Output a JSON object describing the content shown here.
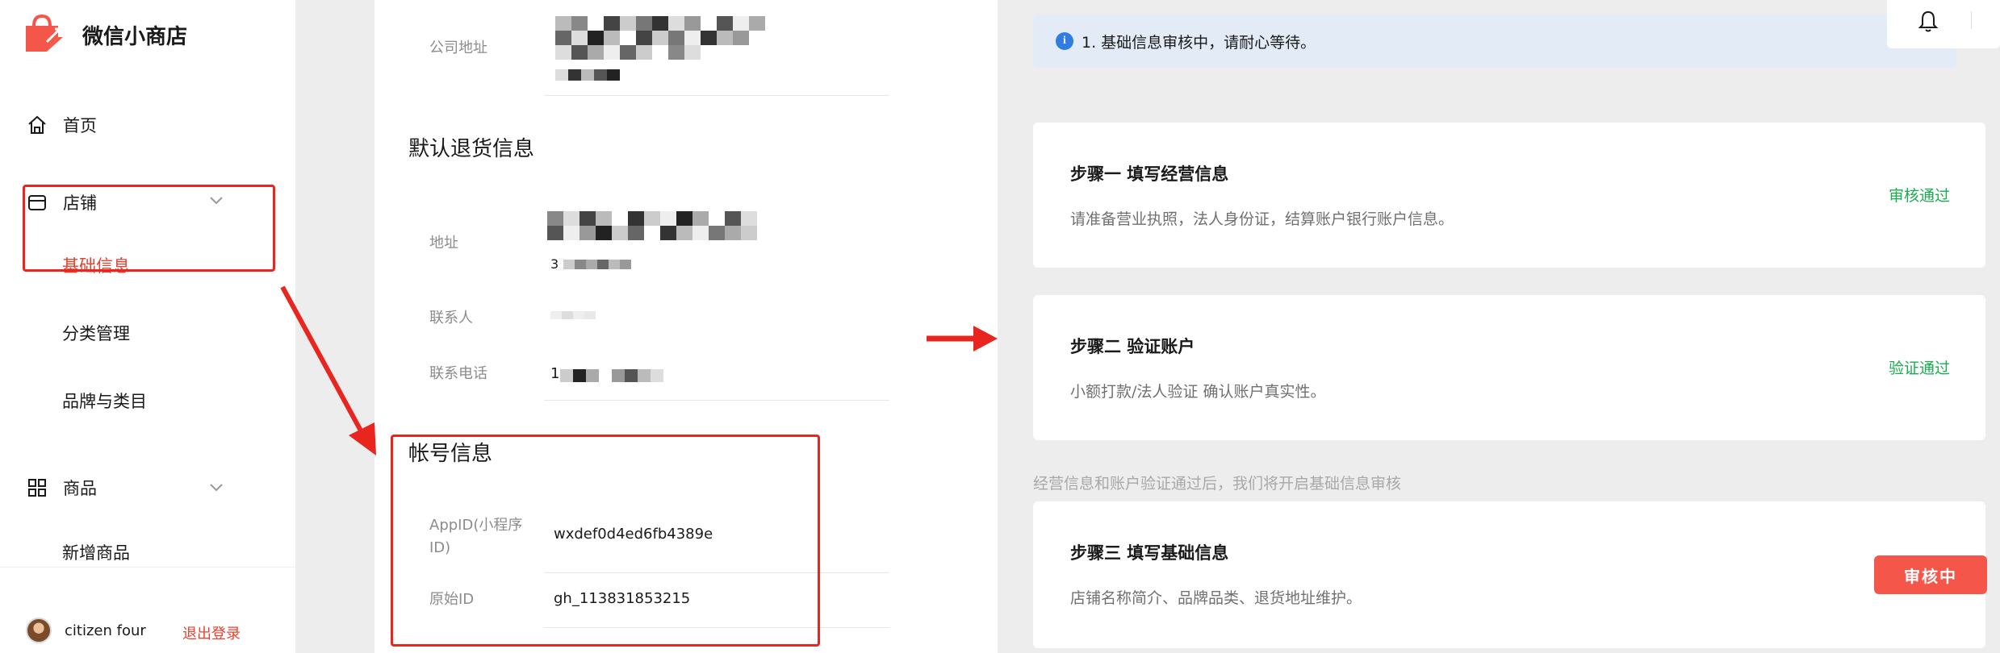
{
  "sidebar": {
    "brand_name": "微信小商店",
    "nav": {
      "home": "首页",
      "store": "店铺",
      "store_sub": [
        "基础信息",
        "分类管理",
        "品牌与类目"
      ],
      "goods": "商品",
      "goods_sub": [
        "新增商品"
      ]
    },
    "user_name": "citizen four",
    "logout": "退出登录"
  },
  "middle": {
    "company_address_label": "公司地址",
    "return_section_title": "默认退货信息",
    "address_label": "地址",
    "contact_label": "联系人",
    "phone_label": "联系电话",
    "phone_value_prefix": "1",
    "address_partial": "3",
    "account_section_title": "帐号信息",
    "appid_label": "AppID(小程序ID)",
    "appid_value": "wxdef0d4ed6fb4389e",
    "original_id_label": "原始ID",
    "original_id_value": "gh_113831853215"
  },
  "right": {
    "notice": "1. 基础信息审核中，请耐心等待。",
    "steps": [
      {
        "title": "步骤一   填写经营信息",
        "desc": "请准备营业执照，法人身份证，结算账户银行账户信息。",
        "status": "审核通过"
      },
      {
        "title": "步骤二   验证账户",
        "desc": "小额打款/法人验证 确认账户真实性。",
        "status": "验证通过"
      },
      {
        "title": "步骤三   填写基础信息",
        "desc": "店铺名称简介、品牌品类、退货地址维护。",
        "status": "审核中"
      }
    ],
    "hint": "经营信息和账户验证通过后，我们将开启基础信息审核"
  },
  "colors": {
    "accent_red": "#e8412d",
    "annotation_red": "#e8251f",
    "success_green": "#1aad4f",
    "button_red": "#f4574a",
    "notice_blue": "#e2ebf6"
  },
  "icons": [
    "shop-bag-logo-icon",
    "home-icon",
    "store-icon",
    "chevron-down-icon",
    "grid-icon",
    "info-icon",
    "bell-icon"
  ]
}
